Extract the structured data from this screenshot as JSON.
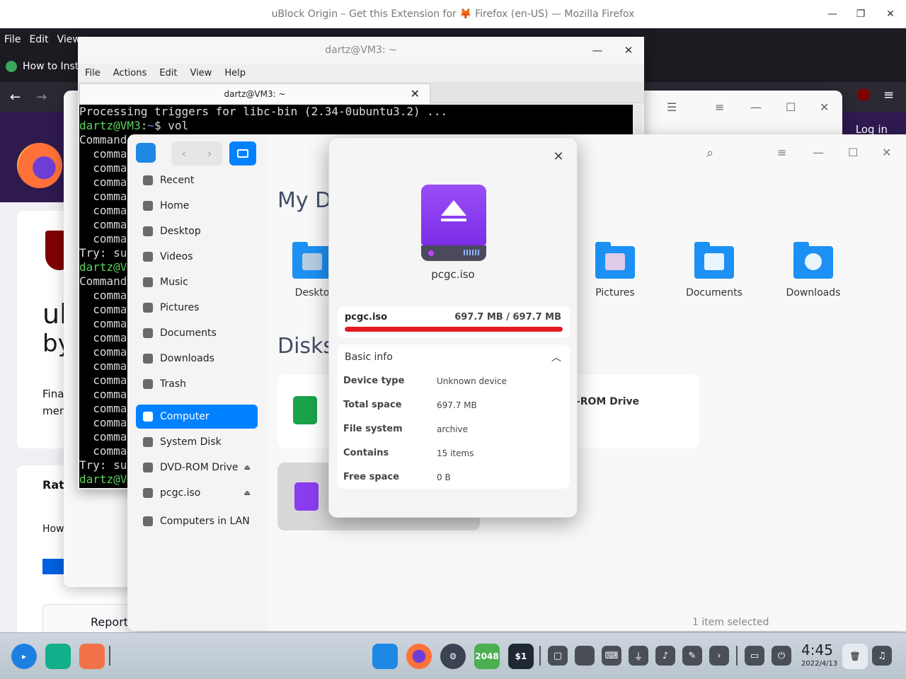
{
  "firefox": {
    "title": "uBlock Origin – Get this Extension for 🦊 Firefox (en-US) — Mozilla Firefox",
    "menu": [
      "File",
      "Edit",
      "View"
    ],
    "tab_label": "How to Insta",
    "login": "Log in",
    "heading1": "ul",
    "heading2": "by",
    "text1": "Fina",
    "text2": "men",
    "rate": "Rate",
    "how": "How",
    "report": "Report"
  },
  "terminal": {
    "title": "dartz@VM3: ~",
    "menu": [
      "File",
      "Actions",
      "Edit",
      "View",
      "Help"
    ],
    "tab_title": "dartz@VM3: ~",
    "lines": [
      "Processing triggers for libc-bin (2.34-0ubuntu3.2) ...",
      "dartz@VM3:~$ vol",
      "Command",
      "  comma",
      "  comma",
      "  comma",
      "  comma",
      "  comma",
      "  comma",
      "  comma",
      "Try: su",
      "dartz@V",
      "Command",
      "  comma",
      "  comma",
      "  comma",
      "  comma",
      "  comma",
      "  comma",
      "  comma",
      "  comma",
      "  comma",
      "  comma",
      "  comma",
      "  comma",
      "Try: su",
      "dartz@V"
    ]
  },
  "file_manager": {
    "sidebar": [
      {
        "label": "Recent",
        "icon": "clock-icon"
      },
      {
        "label": "Home",
        "icon": "home-icon"
      },
      {
        "label": "Desktop",
        "icon": "desktop-icon"
      },
      {
        "label": "Videos",
        "icon": "video-icon"
      },
      {
        "label": "Music",
        "icon": "music-icon"
      },
      {
        "label": "Pictures",
        "icon": "picture-icon"
      },
      {
        "label": "Documents",
        "icon": "document-icon"
      },
      {
        "label": "Downloads",
        "icon": "download-icon"
      },
      {
        "label": "Trash",
        "icon": "trash-icon"
      },
      {
        "label": "Computer",
        "icon": "computer-icon"
      },
      {
        "label": "System Disk",
        "icon": "disk-icon"
      },
      {
        "label": "DVD-ROM Drive",
        "icon": "dvd-icon"
      },
      {
        "label": "pcgc.iso",
        "icon": "usb-icon"
      },
      {
        "label": "Computers in LAN",
        "icon": "network-icon"
      }
    ],
    "section_dirs": "My Di",
    "section_disks": "Disks",
    "folders": [
      "Deskto",
      "Pictures",
      "Documents",
      "Downloads"
    ],
    "dvd_label": "D-ROM Drive",
    "status": "1 item selected",
    "accent": "#0081ff"
  },
  "dialog": {
    "name": "pcgc.iso",
    "usage_name": "pcgc.iso",
    "usage_value": "697.7 MB / 697.7 MB",
    "usage_fraction": 1.0,
    "usage_color": "#e31a23",
    "section": "Basic info",
    "rows": [
      {
        "k": "Device type",
        "v": "Unknown device"
      },
      {
        "k": "Total space",
        "v": "697.7 MB"
      },
      {
        "k": "File system",
        "v": "archive"
      },
      {
        "k": "Contains",
        "v": "15 items"
      },
      {
        "k": "Free space",
        "v": "0 B"
      }
    ]
  },
  "dock": {
    "game_label": "2048",
    "terminal_label": "$1",
    "time": "4:45",
    "date": "2022/4/13"
  }
}
